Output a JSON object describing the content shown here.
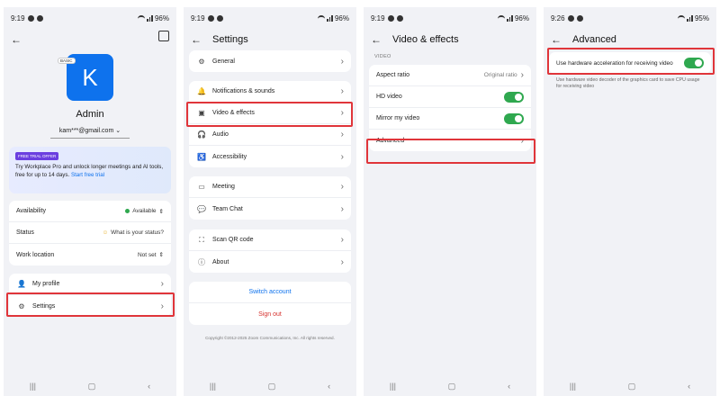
{
  "status_bars": [
    {
      "time": "9:19",
      "battery": "96%"
    },
    {
      "time": "9:19",
      "battery": "96%"
    },
    {
      "time": "9:19",
      "battery": "96%"
    },
    {
      "time": "9:26",
      "battery": "95%"
    }
  ],
  "profile": {
    "badge": "BASIC",
    "initial": "K",
    "name": "Admin",
    "email": "kam***@gmail.com",
    "promo": {
      "badge": "FREE TRIAL OFFER",
      "text": "Try Workplace Pro and unlock longer meetings and AI tools, free for up to 14 days.",
      "link": "Start free trial"
    },
    "info_rows": [
      {
        "label": "Availability",
        "value": "Available"
      },
      {
        "label": "Status",
        "value": "What is your status?"
      },
      {
        "label": "Work location",
        "value": "Not set"
      }
    ],
    "menu": [
      {
        "label": "My profile"
      },
      {
        "label": "Settings"
      }
    ]
  },
  "settings": {
    "title": "Settings",
    "group1": [
      {
        "label": "General"
      }
    ],
    "group2": [
      {
        "label": "Notifications & sounds"
      },
      {
        "label": "Video & effects"
      },
      {
        "label": "Audio"
      },
      {
        "label": "Accessibility"
      }
    ],
    "group3": [
      {
        "label": "Meeting"
      },
      {
        "label": "Team Chat"
      }
    ],
    "group4": [
      {
        "label": "Scan QR code"
      },
      {
        "label": "About"
      }
    ],
    "switch_account": "Switch account",
    "sign_out": "Sign out",
    "copyright": "Copyright ©2012-2025 Zoom Communications, Inc. All rights reserved."
  },
  "video": {
    "title": "Video & effects",
    "section": "VIDEO",
    "aspect_label": "Aspect ratio",
    "aspect_value": "Original ratio",
    "hd_label": "HD video",
    "hd_on": true,
    "mirror_label": "Mirror my video",
    "mirror_on": true,
    "advanced_label": "Advanced"
  },
  "advanced": {
    "title": "Advanced",
    "hw_label": "Use hardware acceleration for receiving video",
    "hw_on": true,
    "hw_desc": "Use hardware video decoder of the graphics card to save CPU usage for receiving video"
  },
  "colors": {
    "accent": "#0e72ed",
    "highlight": "#e0353a",
    "toggle": "#2fa84f",
    "signout": "#d6332f"
  }
}
